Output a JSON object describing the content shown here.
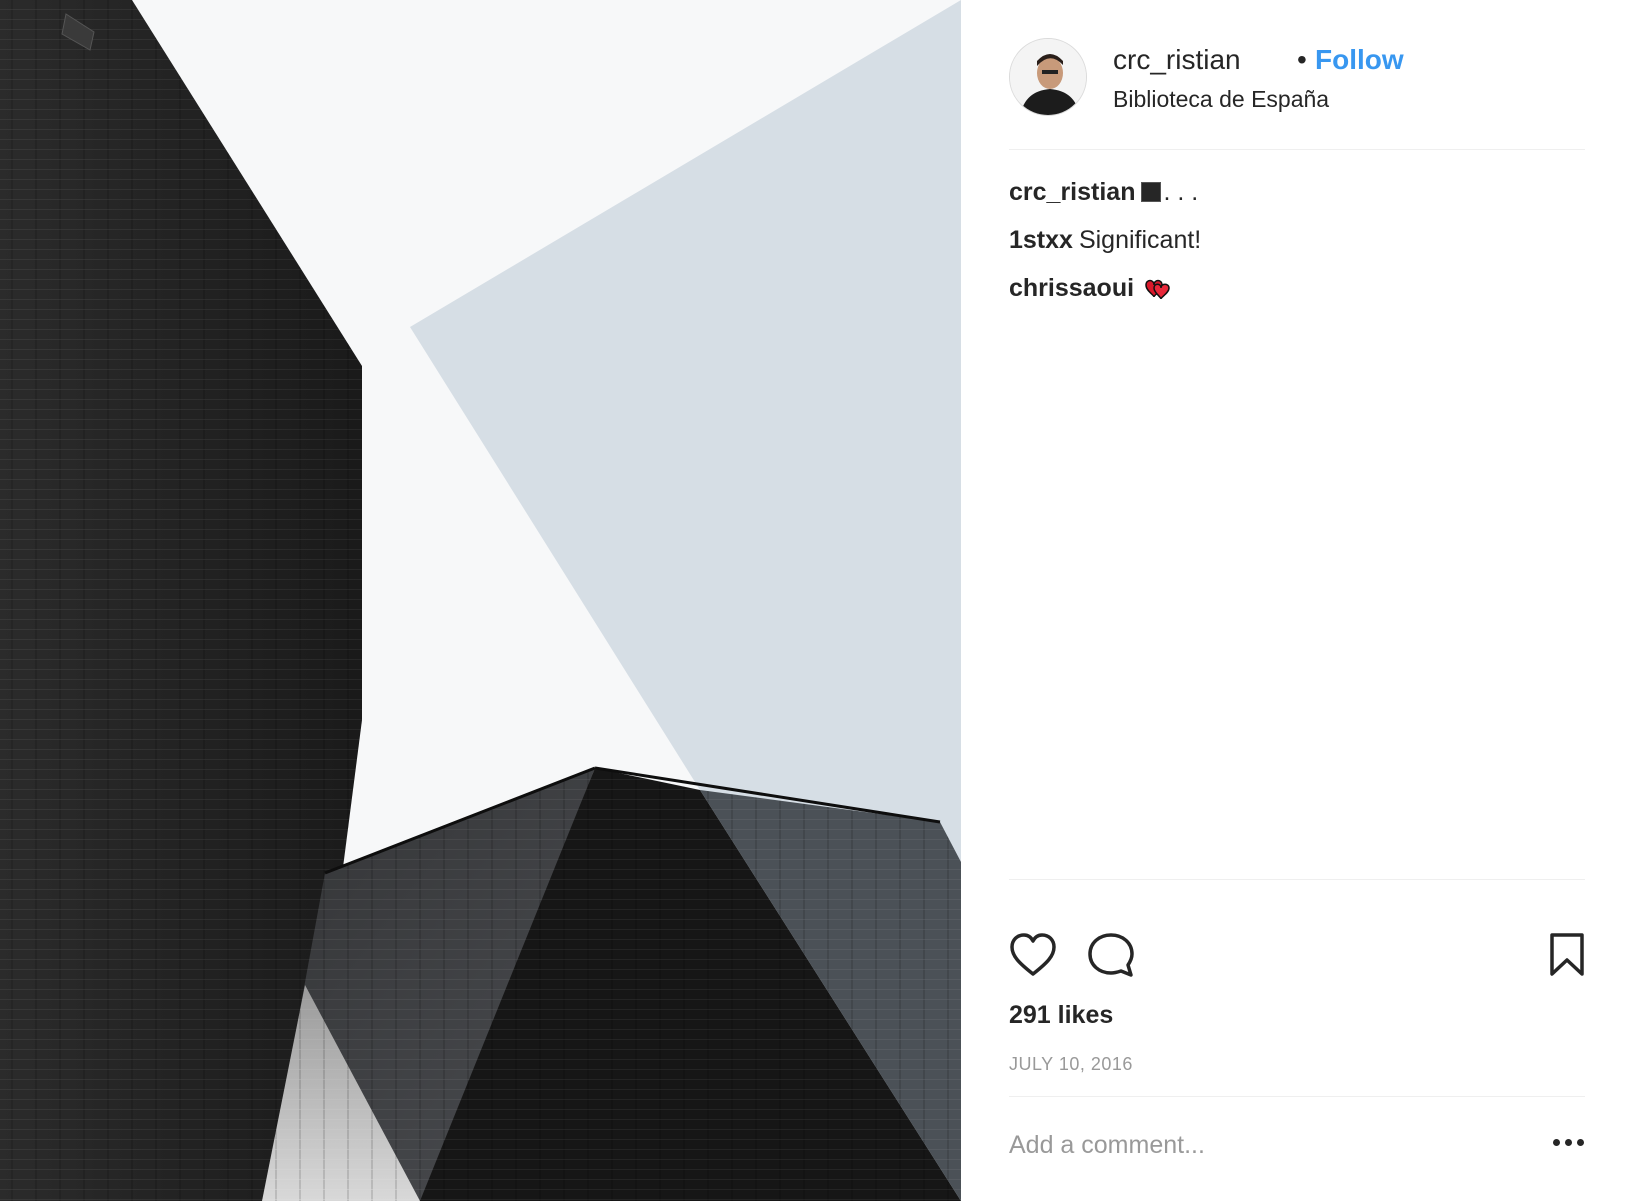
{
  "post": {
    "image_alt": "crc_ristian photo",
    "image_colors": {
      "sky": "#f7f8f9",
      "overlay": "#d6dee5",
      "dark": "#1e1e1e"
    }
  },
  "header": {
    "username": "crc_ristian",
    "separator": "•",
    "follow_label": "Follow",
    "location": "Biblioteca de España"
  },
  "comments": [
    {
      "user": "crc_ristian",
      "text": ". . .",
      "emoji": "black-square"
    },
    {
      "user": "1stxx",
      "text": "Significant!"
    },
    {
      "user": "chrissaoui",
      "text": "",
      "emoji": "red-hearts"
    }
  ],
  "actions": {
    "like_icon": "heart-icon",
    "comment_icon": "comment-icon",
    "save_icon": "bookmark-icon"
  },
  "likes": "291 likes",
  "date": "JULY 10, 2016",
  "comment_box": {
    "placeholder": "Add a comment...",
    "more_icon": "more-options-icon"
  },
  "colors": {
    "accent": "#3897f0",
    "text": "#262626",
    "muted": "#999999",
    "divider": "#efefef"
  }
}
